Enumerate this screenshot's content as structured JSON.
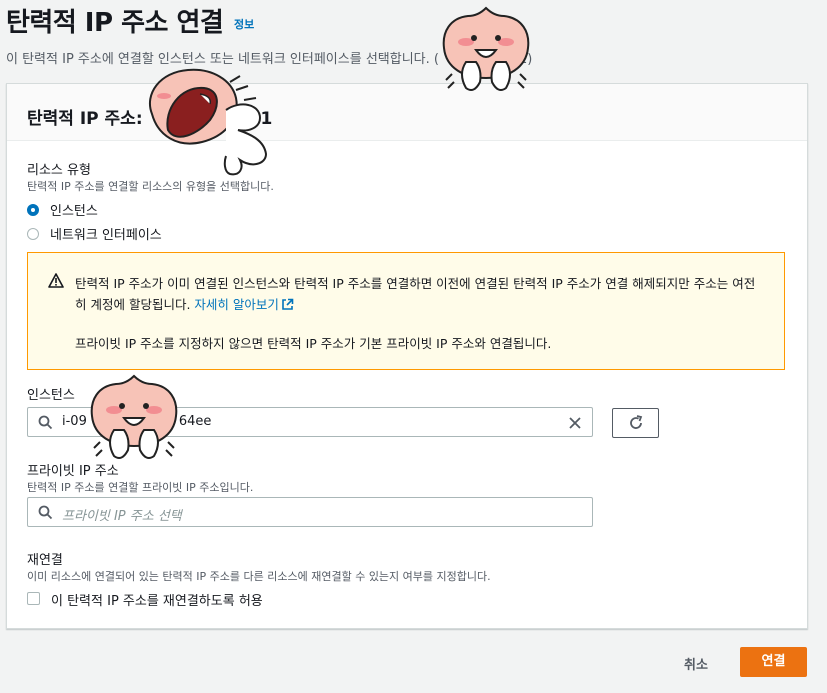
{
  "page": {
    "title": "탄력적 IP 주소 연결",
    "info_link": "정보",
    "description": "이 탄력적 IP 주소에 연결할 인스턴스 또는 네트워크 인터페이스를 선택합니다. (",
    "description_tail": "1)"
  },
  "panel": {
    "title": "탄력적 IP 주소: ",
    "title_tail": "1"
  },
  "resource_type": {
    "label": "리소스 유형",
    "description": "탄력적 IP 주소를 연결할 리소스의 유형을 선택합니다.",
    "options": [
      {
        "label": "인스턴스",
        "selected": true
      },
      {
        "label": "네트워크 인터페이스",
        "selected": false
      }
    ]
  },
  "alert": {
    "text": "탄력적 IP 주소가 이미 연결된 인스턴스와 탄력적 IP 주소를 연결하면 이전에 연결된 탄력적 IP 주소가 연결 해제되지만 주소는 여전히 계정에 할당됩니다.",
    "link": "자세히 알아보기",
    "text2": "프라이빗 IP 주소를 지정하지 않으면 탄력적 IP 주소가 기본 프라이빗 IP 주소와 연결됩니다."
  },
  "instance": {
    "label": "인스턴스",
    "value_prefix": "i-09",
    "value_suffix": "64ee"
  },
  "private_ip": {
    "label": "프라이빗 IP 주소",
    "description": "탄력적 IP 주소를 연결할 프라이빗 IP 주소입니다.",
    "placeholder": "프라이빗 IP 주소 선택"
  },
  "reassociation": {
    "label": "재연결",
    "description": "이미 리소스에 연결되어 있는 탄력적 IP 주소를 다른 리소스에 재연결할 수 있는지 여부를 지정합니다.",
    "checkbox_label": "이 탄력적 IP 주소를 재연결하도록 허용",
    "checked": false
  },
  "footer": {
    "cancel": "취소",
    "connect": "연결"
  },
  "colors": {
    "primary_button": "#ec7211",
    "link": "#0073bb",
    "alert_border": "#ff9900",
    "alert_bg": "#fffce9"
  }
}
